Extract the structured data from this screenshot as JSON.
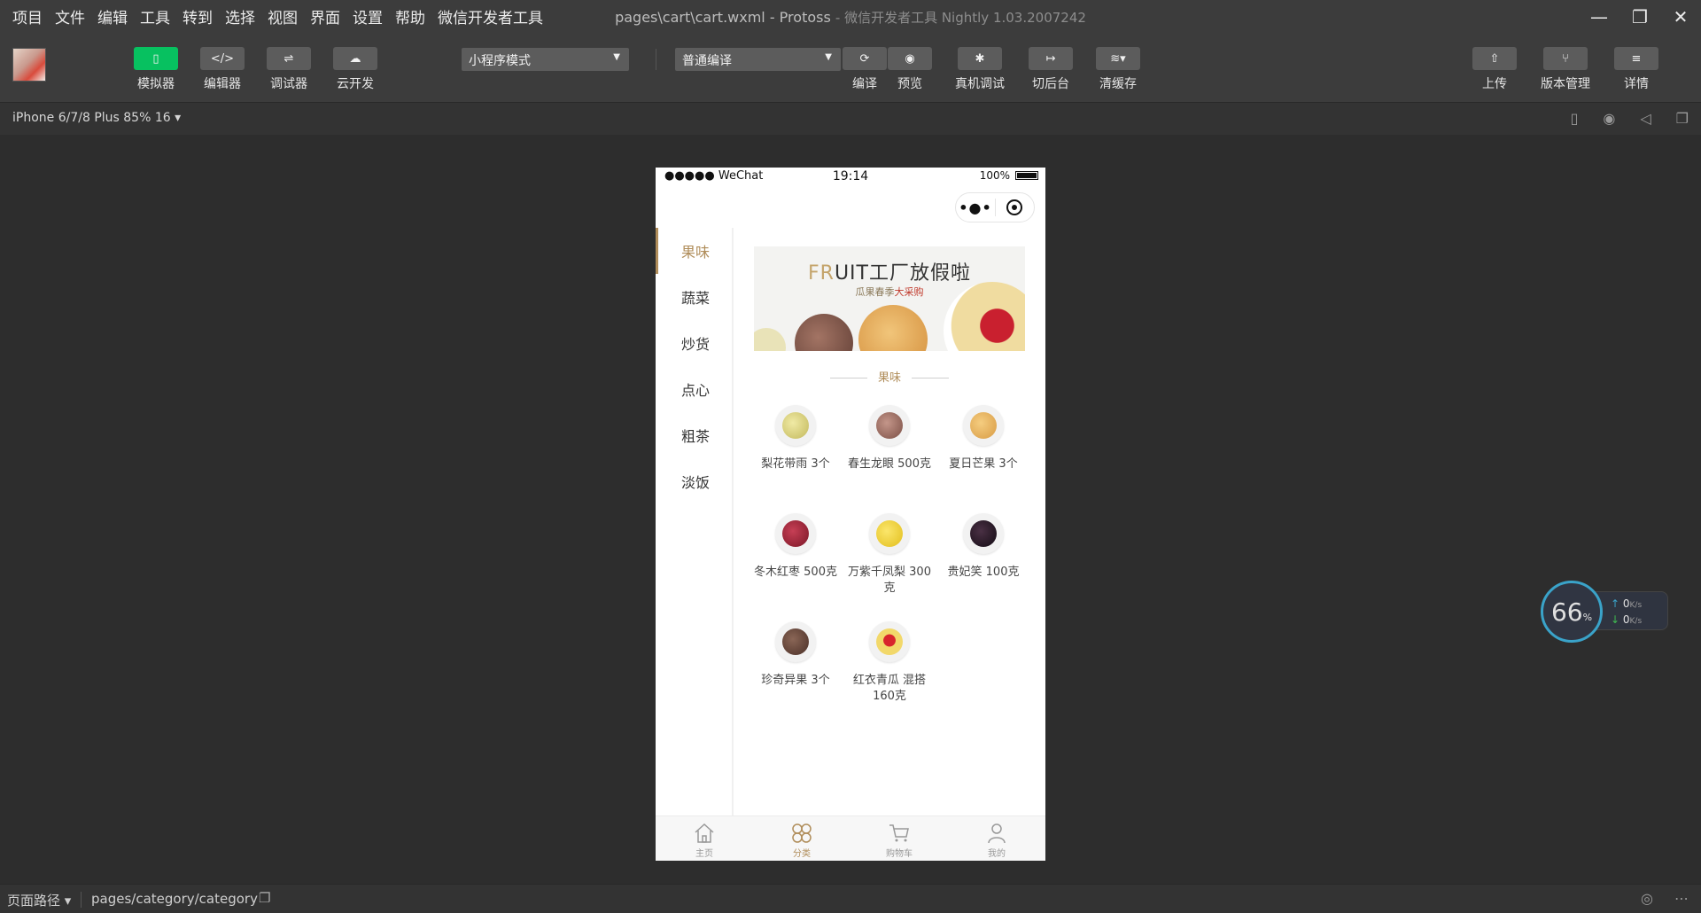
{
  "menu": [
    "项目",
    "文件",
    "编辑",
    "工具",
    "转到",
    "选择",
    "视图",
    "界面",
    "设置",
    "帮助",
    "微信开发者工具"
  ],
  "window": {
    "title": "pages\\cart\\cart.wxml - Protoss",
    "subtitle": "- 微信开发者工具 Nightly 1.03.2007242",
    "controls": [
      "—",
      "❐",
      "✕"
    ]
  },
  "toolbar": {
    "simulator": "模拟器",
    "editor": "编辑器",
    "debugger": "调试器",
    "cloud": "云开发",
    "mode": "小程序模式",
    "compile_mode": "普通编译",
    "compile": "编译",
    "preview": "预览",
    "remote_debug": "真机调试",
    "background": "切后台",
    "clear_cache": "清缓存",
    "upload": "上传",
    "version": "版本管理",
    "details": "详情"
  },
  "device": {
    "label": "iPhone 6/7/8 Plus 85% 16 ▾"
  },
  "phone": {
    "carrier": "●●●●● WeChat",
    "time": "19:14",
    "battery": "100%",
    "capsule_dots": "•●•",
    "categories": [
      "果味",
      "蔬菜",
      "炒货",
      "点心",
      "粗茶",
      "淡饭"
    ],
    "banner": {
      "title_fr": "FR",
      "title_rest": "UIT工厂放假啦",
      "sub_plain": "瓜果春季",
      "sub_red": "大采购"
    },
    "section_title": "果味",
    "products": [
      {
        "name": "梨花带雨 3个",
        "color": "#d9d38a"
      },
      {
        "name": "春生龙眼 500克",
        "color": "#9b6b5a"
      },
      {
        "name": "夏日芒果 3个",
        "color": "#e8b25a"
      },
      {
        "name": "冬木红枣 500克",
        "color": "#9b2b3a"
      },
      {
        "name": "万紫千凤梨 300克",
        "color": "#f2d53c"
      },
      {
        "name": "贵妃笑 100克",
        "color": "#2a1e2a"
      },
      {
        "name": "珍奇异果 3个",
        "color": "#6b4a3e"
      },
      {
        "name": "红衣青瓜 混搭160克",
        "color": "#e9c24a"
      }
    ],
    "tabs": [
      "主页",
      "分类",
      "购物车",
      "我的"
    ]
  },
  "speed": {
    "percent": "66",
    "unit": "%",
    "up": "0",
    "down": "0",
    "rate_unit": "K/s"
  },
  "bottom": {
    "page_path_label": "页面路径 ▾",
    "path": "pages/category/category"
  },
  "colors": {
    "accent": "#b08d5a",
    "green": "#07c160"
  }
}
